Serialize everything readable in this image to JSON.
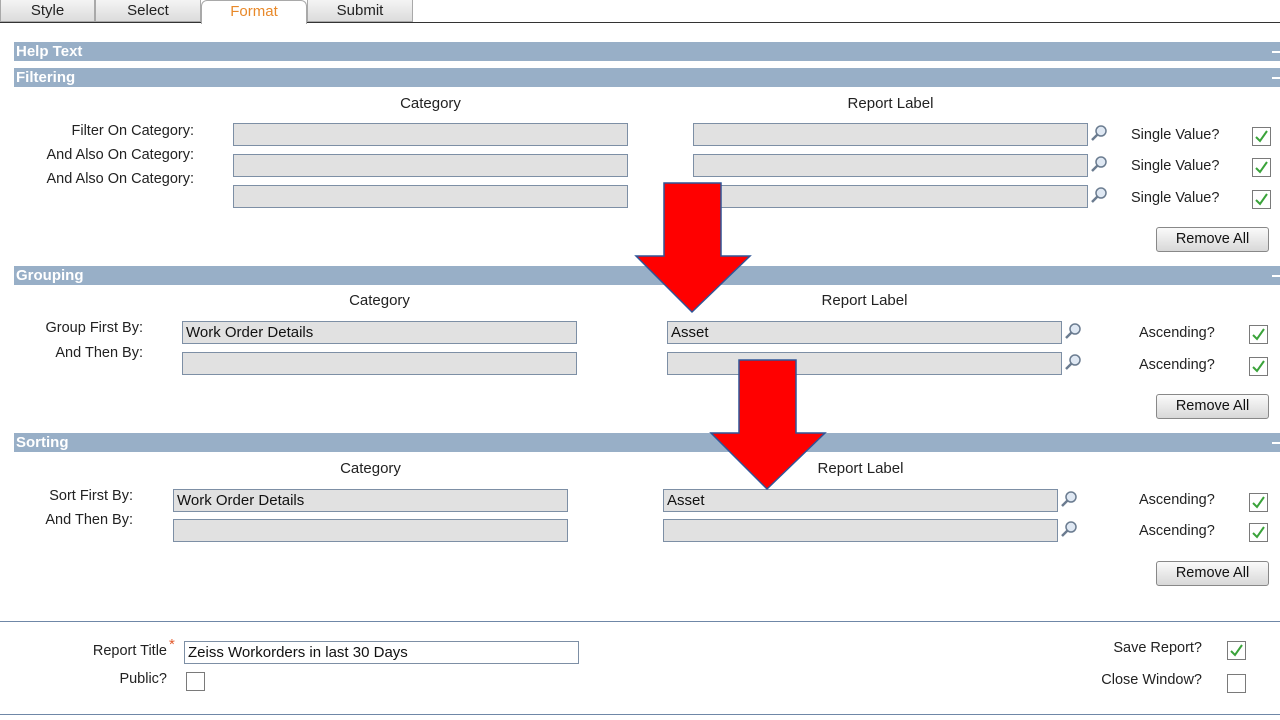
{
  "tabs": [
    {
      "label": "Style"
    },
    {
      "label": "Select"
    },
    {
      "label": "Format"
    },
    {
      "label": "Submit"
    }
  ],
  "sections": {
    "help": {
      "title": "Help Text"
    },
    "filtering": {
      "title": "Filtering",
      "col_category": "Category",
      "col_report_label": "Report Label",
      "rows": [
        {
          "label": "Filter On Category:",
          "category": "",
          "report_label": "",
          "option": "Single Value?"
        },
        {
          "label": "And Also On Category:",
          "category": "",
          "report_label": "",
          "option": "Single Value?"
        },
        {
          "label": "And Also On Category:",
          "category": "",
          "report_label": "",
          "option": "Single Value?"
        }
      ],
      "remove_all": "Remove All"
    },
    "grouping": {
      "title": "Grouping",
      "col_category": "Category",
      "col_report_label": "Report Label",
      "rows": [
        {
          "label": "Group First By:",
          "category": "Work Order Details",
          "report_label": "Asset",
          "option": "Ascending?"
        },
        {
          "label": "And Then By:",
          "category": "",
          "report_label": "",
          "option": "Ascending?"
        }
      ],
      "remove_all": "Remove All"
    },
    "sorting": {
      "title": "Sorting",
      "col_category": "Category",
      "col_report_label": "Report Label",
      "rows": [
        {
          "label": "Sort First By:",
          "category": "Work Order Details",
          "report_label": "Asset",
          "option": "Ascending?"
        },
        {
          "label": "And Then By:",
          "category": "",
          "report_label": "",
          "option": "Ascending?"
        }
      ],
      "remove_all": "Remove All"
    }
  },
  "footer": {
    "report_title_label": "Report Title",
    "required_mark": "*",
    "report_title_value": "Zeiss Workorders in last 30 Days",
    "public_label": "Public?",
    "save_report_label": "Save Report?",
    "close_window_label": "Close Window?"
  },
  "colors": {
    "section_bar": "#98afc7",
    "active_tab_text": "#e8892a",
    "arrow": "#ff0000",
    "check": "#3aa33a"
  }
}
